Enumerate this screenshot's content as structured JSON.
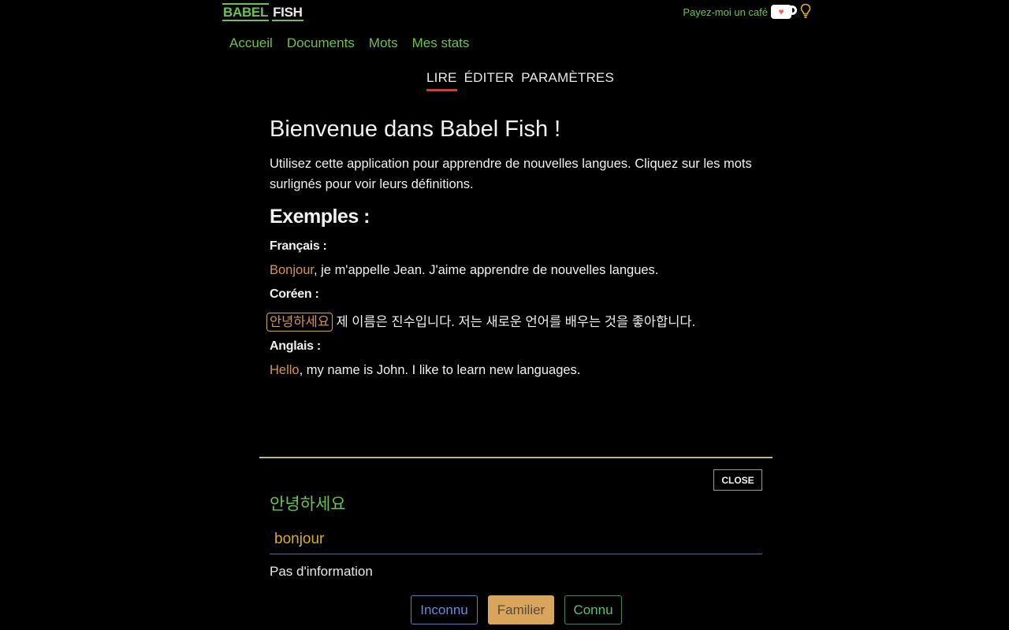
{
  "header": {
    "logo_part1": "BABEL",
    "logo_part2": "FISH",
    "coffee_text": "Payez-moi un café",
    "coffee_icon": "kofi-cup-icon",
    "theme_icon": "lightbulb-icon"
  },
  "nav": {
    "items": [
      {
        "label": "Accueil"
      },
      {
        "label": "Documents"
      },
      {
        "label": "Mots"
      },
      {
        "label": "Mes stats"
      }
    ]
  },
  "tabs": {
    "active": "LIRE",
    "items": [
      {
        "label": "LIRE"
      },
      {
        "label": "ÉDITER"
      },
      {
        "label": "PARAMÈTRES"
      }
    ]
  },
  "document": {
    "title": "Bienvenue dans Babel Fish !",
    "intro": "Utilisez cette application pour apprendre de nouvelles langues. Cliquez sur les mots surlignés pour voir leurs définitions.",
    "examples_heading": "Exemples :",
    "examples": [
      {
        "label": "Français :",
        "highlight": "Bonjour",
        "rest": ", je m'appelle Jean. J'aime apprendre de nouvelles langues."
      },
      {
        "label": "Coréen :",
        "highlight": "안녕하세요",
        "rest": " 제 이름은 진수입니다. 저는 새로운 언어를 배우는 것을 좋아합니다."
      },
      {
        "label": "Anglais :",
        "highlight": "Hello",
        "rest": ", my name is John. I like to learn new languages."
      }
    ]
  },
  "panel": {
    "close_label": "CLOSE",
    "word": "안녕하세요",
    "translation_value": "bonjour",
    "info_text": "Pas d'information",
    "levels": {
      "unknown": "Inconnu",
      "familiar": "Familier",
      "known": "Connu"
    },
    "selected_level": "Familier"
  },
  "colors": {
    "accent_green": "#6cc24a",
    "highlight_word": "#d4954a",
    "active_tab_underline": "#d9383a",
    "familiar_bg": "#d9a55c"
  }
}
